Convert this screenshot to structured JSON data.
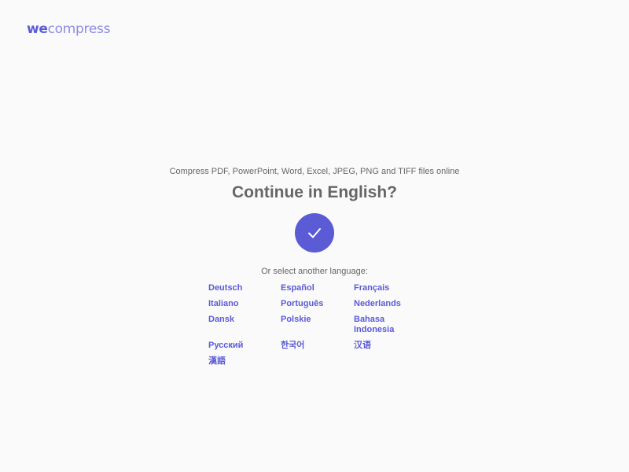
{
  "logo": {
    "part1": "we",
    "part2": "compress"
  },
  "tagline": "Compress PDF, PowerPoint, Word, Excel, JPEG, PNG and TIFF files online",
  "heading": "Continue in English?",
  "confirm_button": {
    "icon": "checkmark-icon"
  },
  "or_select": "Or select another language:",
  "languages": [
    "Deutsch",
    "Español",
    "Français",
    "Italiano",
    "Português",
    "Nederlands",
    "Dansk",
    "Polskie",
    "Bahasa Indonesia",
    "Русский",
    "한국어",
    "汉语",
    "漢語"
  ],
  "colors": {
    "accent": "#5b5bd6",
    "text_muted": "#666666",
    "background": "#fafafa"
  }
}
